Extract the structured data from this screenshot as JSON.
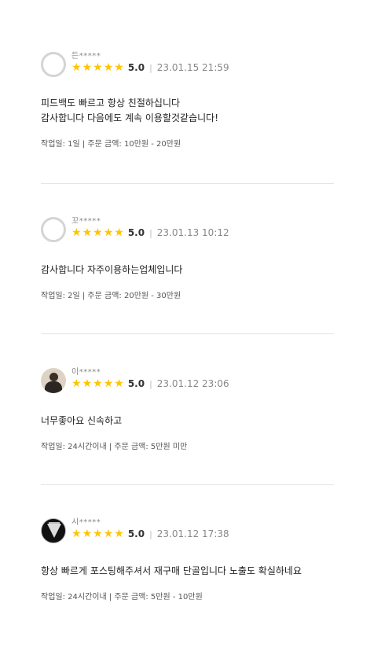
{
  "star_glyph": "★",
  "reviews": [
    {
      "nickname": "든*****",
      "avatar": "default-avatar",
      "score": "5.0",
      "separator": "|",
      "date": "23.01.15 21:59",
      "content": "피드백도 빠르고 항상 친절하십니다\n감사합니다 다음에도 계속 이용할것같습니다!",
      "meta": "작업일: 1일 | 주문 금액: 10만원 - 20만원"
    },
    {
      "nickname": "꼬*****",
      "avatar": "default-avatar",
      "score": "5.0",
      "separator": "|",
      "date": "23.01.13 10:12",
      "content": "감사합니다 자주이용하는업체입니다",
      "meta": "작업일: 2일 | 주문 금액: 20만원 - 30만원"
    },
    {
      "nickname": "이*****",
      "avatar": "photo-avatar",
      "score": "5.0",
      "separator": "|",
      "date": "23.01.12 23:06",
      "content": "너무좋아요 신속하고",
      "meta": "작업일: 24시간이내 | 주문 금액: 5만원 미만"
    },
    {
      "nickname": "시*****",
      "avatar": "gem-avatar",
      "score": "5.0",
      "separator": "|",
      "date": "23.01.12 17:38",
      "content": "항상 빠르게 포스팅해주셔서 재구매 단골입니다 노출도 확실하네요",
      "meta": "작업일: 24시간이내 | 주문 금액: 5만원 - 10만원"
    }
  ],
  "colors": {
    "star": "#ffc400",
    "divider": "#e4e4e4",
    "text": "#222222",
    "muted": "#888888"
  }
}
